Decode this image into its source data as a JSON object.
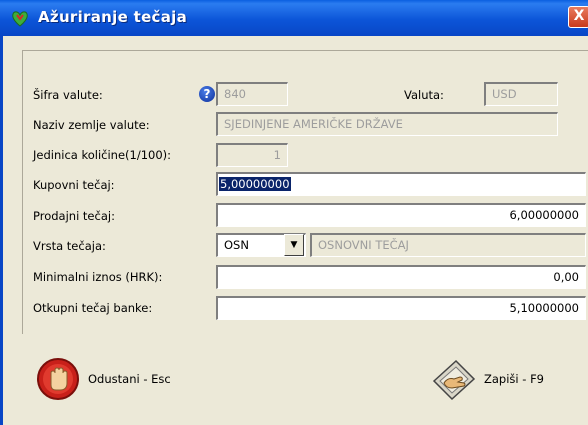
{
  "window": {
    "title": "Ažuriranje tečaja",
    "close_label": "X"
  },
  "form": {
    "sifra_label": "Šifra valute:",
    "sifra_value": "840",
    "valuta_label": "Valuta:",
    "valuta_value": "USD",
    "naziv_label": "Naziv zemlje valute:",
    "naziv_value": "SJEDINJENE AMERIČKE DRŽAVE",
    "jedinica_label": "Jedinica količine(1/100):",
    "jedinica_value": "1",
    "kupovni_label": "Kupovni tečaj:",
    "kupovni_value": "5,00000000",
    "prodajni_label": "Prodajni tečaj:",
    "prodajni_value": "6,00000000",
    "vrsta_label": "Vrsta tečaja:",
    "vrsta_value": "OSN",
    "vrsta_desc": "OSNOVNI TEČAJ",
    "minimalni_label": "Minimalni iznos (HRK):",
    "minimalni_value": "0,00",
    "otkupni_label": "Otkupni tečaj banke:",
    "otkupni_value": "5,10000000"
  },
  "buttons": {
    "cancel_label": "Odustani - Esc",
    "save_label": "Zapiši - F9"
  },
  "icons": {
    "title": "app-icon",
    "help": "help-icon",
    "dropdown": "chevron-down-icon",
    "cancel": "stop-hand-icon",
    "save": "save-hand-icon"
  }
}
